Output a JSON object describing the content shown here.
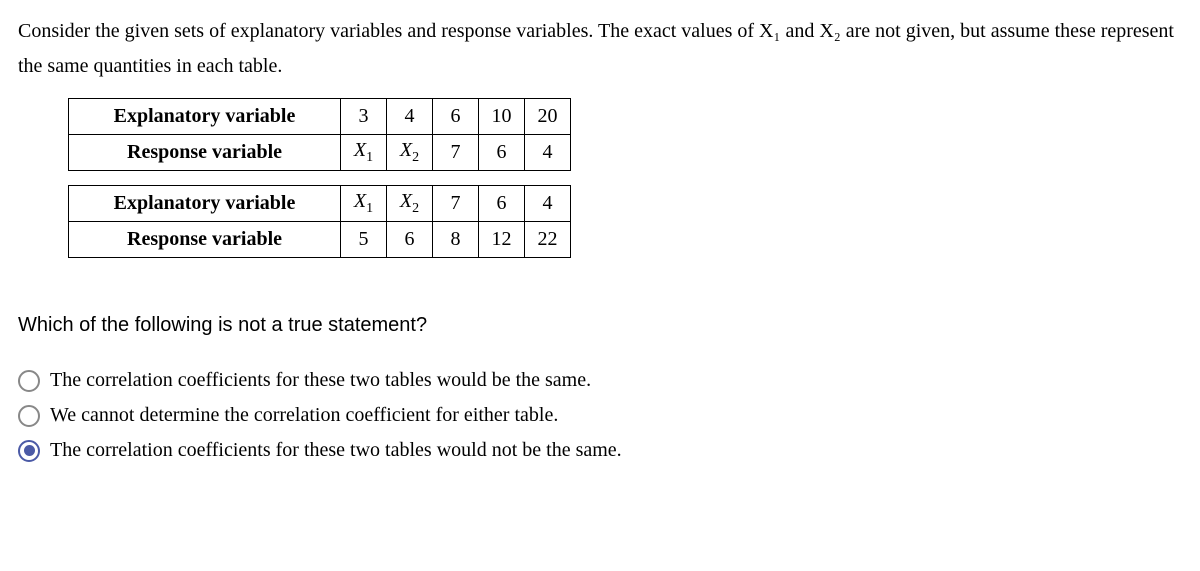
{
  "intro": "Consider the given sets of explanatory variables and response variables. The exact values of X₁ and X₂ are not given, but assume these represent the same quantities in each table.",
  "table1": {
    "row1_label": "Explanatory variable",
    "row1": [
      "3",
      "4",
      "6",
      "10",
      "20"
    ],
    "row2_label": "Response variable",
    "row2": [
      "X₁",
      "X₂",
      "7",
      "6",
      "4"
    ]
  },
  "table2": {
    "row1_label": "Explanatory variable",
    "row1": [
      "X₁",
      "X₂",
      "7",
      "6",
      "4"
    ],
    "row2_label": "Response variable",
    "row2": [
      "5",
      "6",
      "8",
      "12",
      "22"
    ]
  },
  "question": "Which of the following is not a true statement?",
  "options": [
    {
      "text": "The correlation coefficients for these two tables would be the same.",
      "selected": false
    },
    {
      "text": "We cannot determine the correlation coefficient for either table.",
      "selected": false
    },
    {
      "text": "The correlation coefficients for these two tables would not be the same.",
      "selected": true
    }
  ]
}
